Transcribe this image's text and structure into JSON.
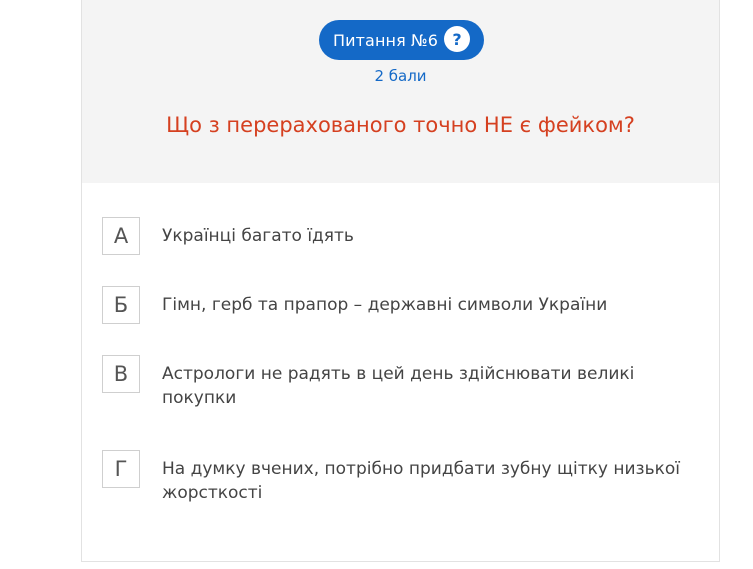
{
  "question_header": {
    "label": "Питання №6",
    "help_icon": "question-mark-icon",
    "help_glyph": "?",
    "points": "2 бали"
  },
  "question": {
    "text": "Що з перерахованого точно НЕ є фейком?"
  },
  "answers": [
    {
      "letter": "А",
      "text": "Українці багато їдять"
    },
    {
      "letter": "Б",
      "text": "Гімн, герб та прапор – державні символи України"
    },
    {
      "letter": "В",
      "text": "Астрологи не радять в цей день здійснювати великі покупки"
    },
    {
      "letter": "Г",
      "text": "На думку вчених, потрібно придбати зубну щітку низької жорсткості"
    }
  ],
  "colors": {
    "accent_blue": "#1469c7",
    "question_red": "#d54020",
    "header_bg": "#f4f4f4"
  }
}
